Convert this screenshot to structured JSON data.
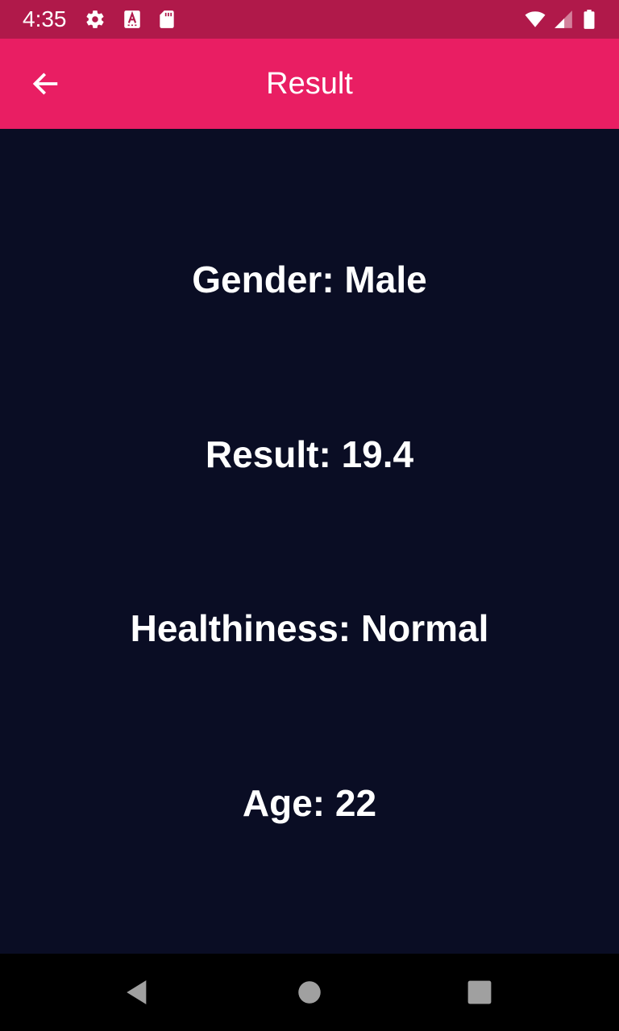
{
  "status_bar": {
    "time": "4:35",
    "left_icons": [
      "gear-icon",
      "text-a-icon",
      "sd-card-icon"
    ],
    "right_icons": [
      "wifi-icon",
      "signal-icon",
      "battery-icon"
    ],
    "background": "#b0194a"
  },
  "app_bar": {
    "title": "Result",
    "back_icon": "arrow-left-icon",
    "background": "#e91e63"
  },
  "results": {
    "gender": "Gender: Male",
    "result": "Result: 19.4",
    "healthiness": "Healthiness: Normal",
    "age": "Age: 22"
  },
  "theme": {
    "content_background": "#0a0d24",
    "text_color": "#ffffff"
  },
  "nav_bar": {
    "buttons": [
      "back-triangle-icon",
      "home-circle-icon",
      "recents-square-icon"
    ]
  }
}
